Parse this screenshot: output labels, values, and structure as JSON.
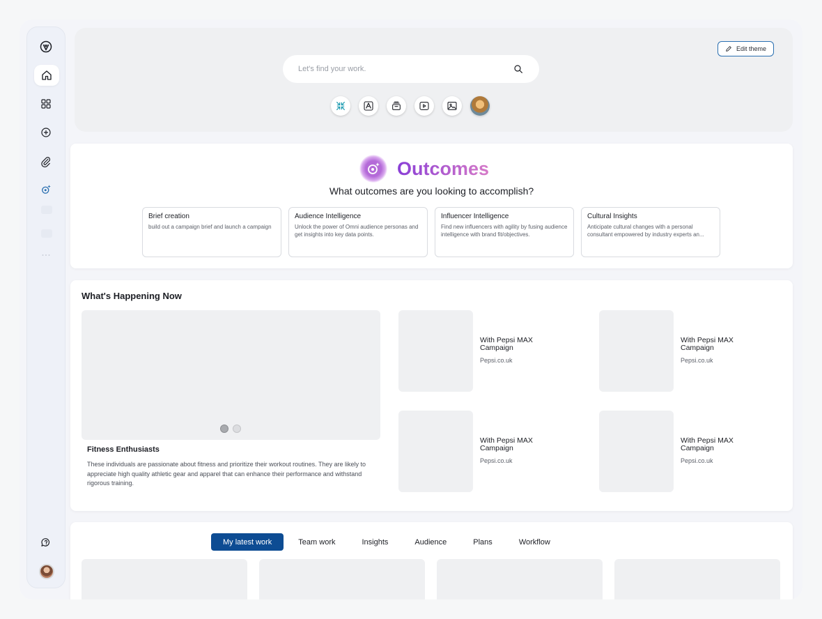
{
  "header": {
    "edit_theme_label": "Edit theme",
    "search_placeholder": "Let's find your work.",
    "quick_icons": [
      "compress-icon",
      "adobe-icon",
      "stack-icon",
      "play-icon",
      "image-icon",
      "avatar"
    ]
  },
  "sidebar": {
    "items": [
      "logo-icon",
      "home-icon",
      "grid-icon",
      "add-circle-icon",
      "attachment-icon",
      "outcomes-orb-icon",
      "more-icon",
      "chat-help-icon",
      "avatar"
    ]
  },
  "outcomes": {
    "title": "Outcomes",
    "subtitle": "What outcomes are you looking to accomplish?",
    "cards": [
      {
        "title": "Brief creation",
        "desc": "build out a campaign brief and launch a campaign"
      },
      {
        "title": "Audience Intelligence",
        "desc": "Unlock the power of Omni audience personas and get insights into key data points."
      },
      {
        "title": "Influencer Intelligence",
        "desc": "Find new influencers with agility by fusing audience intelligence with brand fit/objectives."
      },
      {
        "title": "Cultural Insights",
        "desc": "Anticipate cultural changes with a personal consultant empowered by industry experts an..."
      }
    ]
  },
  "happening": {
    "title": "What's Happening Now",
    "hero_title": "Fitness Enthusiasts",
    "hero_desc": "These individuals are passionate about fitness and prioritize their workout routines. They are likely to appreciate high quality athletic gear and apparel that can enhance their performance and withstand rigorous training.",
    "campaigns": [
      {
        "name": "With Pepsi MAX Campaign",
        "source": "Pepsi.co.uk"
      },
      {
        "name": "With Pepsi MAX Campaign",
        "source": "Pepsi.co.uk"
      },
      {
        "name": "With Pepsi MAX Campaign",
        "source": "Pepsi.co.uk"
      },
      {
        "name": "With Pepsi MAX Campaign",
        "source": "Pepsi.co.uk"
      }
    ]
  },
  "work": {
    "tabs": [
      "My latest work",
      "Team work",
      "Insights",
      "Audience",
      "Plans",
      "Workflow"
    ],
    "active_tab": "My latest work"
  },
  "colors": {
    "accent": "#0d4c93",
    "outcomes_gradient_start": "#8a3fd6",
    "outcomes_gradient_end": "#d67ac8",
    "panel_gray": "#eff0f2"
  }
}
